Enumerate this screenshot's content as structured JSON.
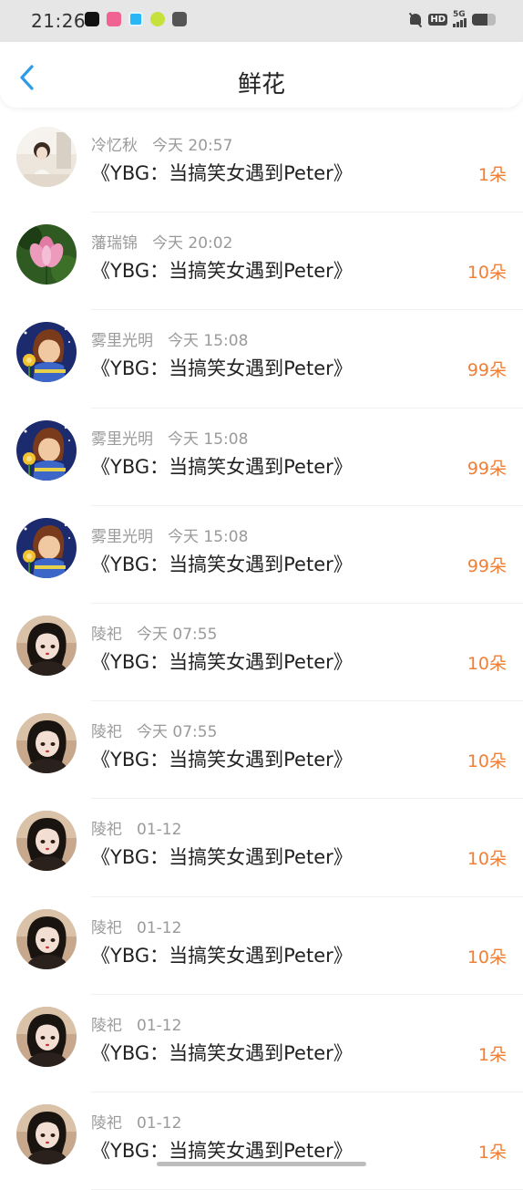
{
  "status_bar": {
    "time": "21:26",
    "network": "5G",
    "hd": "HD",
    "battery_level": 0.65,
    "app_icons": [
      "tiktok-icon",
      "bilibili-icon",
      "app-icon",
      "app-icon",
      "app-icon"
    ]
  },
  "header": {
    "title": "鲜花",
    "back_icon": "chevron-left-icon"
  },
  "colors": {
    "accent": "#2e9be6",
    "count": "#f07f35",
    "meta": "#9a9a9a"
  },
  "items": [
    {
      "name": "冷忆秋",
      "time": "今天  20:57",
      "title": "《YBG：当搞笑女遇到Peter》",
      "count": "1朵",
      "avatar": "girl"
    },
    {
      "name": "藩瑞锦",
      "time": "今天  20:02",
      "title": "《YBG：当搞笑女遇到Peter》",
      "count": "10朵",
      "avatar": "lotus"
    },
    {
      "name": "雾里光明",
      "time": "今天  15:08",
      "title": "《YBG：当搞笑女遇到Peter》",
      "count": "99朵",
      "avatar": "cartoon"
    },
    {
      "name": "雾里光明",
      "time": "今天  15:08",
      "title": "《YBG：当搞笑女遇到Peter》",
      "count": "99朵",
      "avatar": "cartoon"
    },
    {
      "name": "雾里光明",
      "time": "今天  15:08",
      "title": "《YBG：当搞笑女遇到Peter》",
      "count": "99朵",
      "avatar": "cartoon"
    },
    {
      "name": "陵祀",
      "time": "今天  07:55",
      "title": "《YBG：当搞笑女遇到Peter》",
      "count": "10朵",
      "avatar": "doll"
    },
    {
      "name": "陵祀",
      "time": "今天  07:55",
      "title": "《YBG：当搞笑女遇到Peter》",
      "count": "10朵",
      "avatar": "doll"
    },
    {
      "name": "陵祀",
      "time": "01-12",
      "title": "《YBG：当搞笑女遇到Peter》",
      "count": "10朵",
      "avatar": "doll"
    },
    {
      "name": "陵祀",
      "time": "01-12",
      "title": "《YBG：当搞笑女遇到Peter》",
      "count": "10朵",
      "avatar": "doll"
    },
    {
      "name": "陵祀",
      "time": "01-12",
      "title": "《YBG：当搞笑女遇到Peter》",
      "count": "1朵",
      "avatar": "doll"
    },
    {
      "name": "陵祀",
      "time": "01-12",
      "title": "《YBG：当搞笑女遇到Peter》",
      "count": "1朵",
      "avatar": "doll"
    }
  ]
}
